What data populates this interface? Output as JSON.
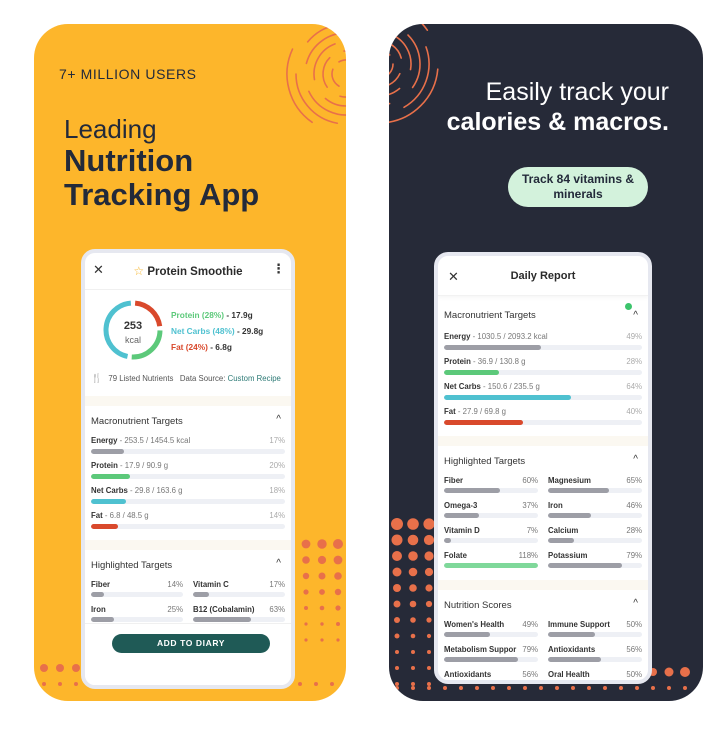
{
  "left_panel": {
    "tagline": "7+ MILLION USERS",
    "headline_light": "Leading",
    "headline_bold_1": "Nutrition",
    "headline_bold_2": "Tracking App",
    "colors": {
      "background": "#fdb62b",
      "accent": "#e8704a",
      "text": "#232a3a"
    },
    "phone": {
      "close_icon": "✕",
      "star_icon": "☆",
      "title": "Protein Smoothie",
      "more_icon": "⋮",
      "calories_value": "253",
      "calories_unit": "kcal",
      "macros": [
        {
          "name": "Protein (28%)",
          "value": "17.9g",
          "percent": 28,
          "color": "#5cc97a"
        },
        {
          "name": "Net Carbs (48%)",
          "value": "29.8g",
          "percent": 48,
          "color": "#4fc1d0"
        },
        {
          "name": "Fat (24%)",
          "value": "6.8g",
          "percent": 24,
          "color": "#d9492c"
        }
      ],
      "listed_nutrients": "79 Listed Nutrients",
      "data_source_label": "Data Source:",
      "data_source_value": "Custom Recipe",
      "macro_targets": {
        "title": "Macronutrient Targets",
        "chevron": "^",
        "rows": [
          {
            "name": "Energy",
            "detail": " - 253.5 / 1454.5 kcal",
            "pct_label": "17%",
            "pct": 17,
            "color": "#9d9ea6"
          },
          {
            "name": "Protein",
            "detail": " - 17.9 / 90.9 g",
            "pct_label": "20%",
            "pct": 20,
            "color": "#5cc97a"
          },
          {
            "name": "Net Carbs",
            "detail": " - 29.8 / 163.6 g",
            "pct_label": "18%",
            "pct": 18,
            "color": "#4fc1d0"
          },
          {
            "name": "Fat",
            "detail": " - 6.8 / 48.5 g",
            "pct_label": "14%",
            "pct": 14,
            "color": "#d9492c"
          }
        ]
      },
      "highlighted_targets": {
        "title": "Highlighted Targets",
        "chevron": "^",
        "items": [
          {
            "name": "Fiber",
            "pct_label": "14%",
            "pct": 14,
            "color": "#9d9ea6"
          },
          {
            "name": "Vitamin C",
            "pct_label": "17%",
            "pct": 17,
            "color": "#9d9ea6"
          },
          {
            "name": "Iron",
            "pct_label": "25%",
            "pct": 25,
            "color": "#9d9ea6"
          },
          {
            "name": "B12 (Cobalamin)",
            "pct_label": "63%",
            "pct": 63,
            "color": "#9d9ea6"
          }
        ]
      },
      "add_button": "ADD TO DIARY"
    }
  },
  "right_panel": {
    "headline_light": "Easily track your",
    "headline_bold": "calories & macros.",
    "callout": "Track 84 vitamins & minerals",
    "colors": {
      "background": "#262a38",
      "accent": "#e8704a",
      "callout": "#d3f2dc"
    },
    "phone": {
      "close_icon": "✕",
      "title": "Daily Report",
      "macro_targets": {
        "title": "Macronutrient Targets",
        "chevron": "^",
        "rows": [
          {
            "name": "Energy",
            "detail": " - 1030.5 / 2093.2 kcal",
            "pct_label": "49%",
            "pct": 49,
            "color": "#9d9ea6"
          },
          {
            "name": "Protein",
            "detail": " - 36.9 / 130.8 g",
            "pct_label": "28%",
            "pct": 28,
            "color": "#5cc97a"
          },
          {
            "name": "Net Carbs",
            "detail": " - 150.6 / 235.5 g",
            "pct_label": "64%",
            "pct": 64,
            "color": "#4fc1d0"
          },
          {
            "name": "Fat",
            "detail": " - 27.9 / 69.8 g",
            "pct_label": "40%",
            "pct": 40,
            "color": "#d9492c"
          }
        ]
      },
      "highlighted_targets": {
        "title": "Highlighted Targets",
        "chevron": "^",
        "items": [
          {
            "name": "Fiber",
            "pct_label": "60%",
            "pct": 60,
            "color": "#9d9ea6"
          },
          {
            "name": "Magnesium",
            "pct_label": "65%",
            "pct": 65,
            "color": "#9d9ea6"
          },
          {
            "name": "Omega-3",
            "pct_label": "37%",
            "pct": 37,
            "color": "#9d9ea6"
          },
          {
            "name": "Iron",
            "pct_label": "46%",
            "pct": 46,
            "color": "#9d9ea6"
          },
          {
            "name": "Vitamin D",
            "pct_label": "7%",
            "pct": 7,
            "color": "#9d9ea6"
          },
          {
            "name": "Calcium",
            "pct_label": "28%",
            "pct": 28,
            "color": "#9d9ea6"
          },
          {
            "name": "Folate",
            "pct_label": "118%",
            "pct": 100,
            "color": "#7fd89a"
          },
          {
            "name": "Potassium",
            "pct_label": "79%",
            "pct": 79,
            "color": "#9d9ea6"
          }
        ]
      },
      "nutrition_scores": {
        "title": "Nutrition Scores",
        "chevron": "^",
        "items": [
          {
            "name": "Women's Health",
            "pct_label": "49%",
            "pct": 49,
            "color": "#9d9ea6"
          },
          {
            "name": "Immune Support",
            "pct_label": "50%",
            "pct": 50,
            "color": "#9d9ea6"
          },
          {
            "name": "Metabolism Suppor",
            "pct_label": "79%",
            "pct": 79,
            "color": "#9d9ea6"
          },
          {
            "name": "Antioxidants",
            "pct_label": "56%",
            "pct": 56,
            "color": "#9d9ea6"
          },
          {
            "name": "Antioxidants",
            "pct_label": "56%",
            "pct": 56,
            "color": "#9d9ea6"
          },
          {
            "name": "Oral Health",
            "pct_label": "50%",
            "pct": 50,
            "color": "#9d9ea6"
          }
        ]
      }
    }
  }
}
